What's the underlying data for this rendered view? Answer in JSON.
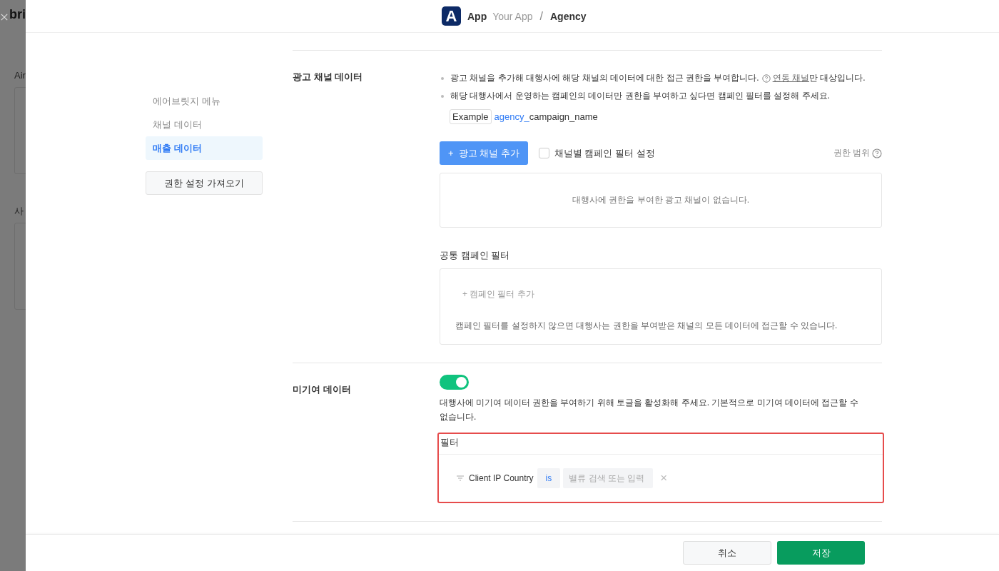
{
  "backdrop": {
    "texts": [
      "bri",
      "Air",
      "사"
    ]
  },
  "header": {
    "logo_letter": "A",
    "app": "App",
    "crumbs": [
      "Your App",
      "Agency"
    ],
    "separator": "/"
  },
  "sidebar": {
    "items": [
      {
        "label": "에어브릿지 메뉴",
        "selected": false
      },
      {
        "label": "채널 데이터",
        "selected": false
      },
      {
        "label": "매출 데이터",
        "selected": true
      }
    ],
    "import_button": "권한 설정 가져오기"
  },
  "ad_channel": {
    "title": "광고 채널 데이터",
    "bullet_1": {
      "text": "광고 채널을 추가해 대행사에 해당 채널의 데이터에 대한 접근 권한을 부여합니다.",
      "link": "연동 채널",
      "after": "만 대상입니다."
    },
    "bullet_2": "해당 대행사에서 운영하는 캠페인의 데이터만 권한을 부여하고 싶다면 캠페인 필터를 설정해 주세요.",
    "example": {
      "tag": "Example",
      "prefix": "agency_",
      "rest": "campaign_name"
    },
    "add_button": {
      "icon": "+",
      "label": "광고 채널 추가"
    },
    "checkbox": {
      "label": "채널별 캠페인 필터 설정",
      "checked": false
    },
    "scope_label": "권한 범위",
    "empty_message": "대행사에 권한을 부여한 광고 채널이 없습니다.",
    "common_filter": {
      "title": "공통 캠페인 필터",
      "add_icon": "+",
      "add_label": "캠페인 필터 추가",
      "note": "캠페인 필터를 설정하지 않으면 대행사는 권한을 부여받은 채널의 모든 데이터에 접근할 수 있습니다."
    }
  },
  "unattributed": {
    "title": "미기여 데이터",
    "toggle": {
      "on": true
    },
    "description": "대행사에 미기여 데이터 권한을 부여하기 위해 토글을 활성화해 주세요. 기본적으로 미기여 데이터에 접근할 수 없습니다.",
    "filter": {
      "title": "필터",
      "highlighted": true,
      "field": "Client IP Country",
      "operator": "is",
      "placeholder": "밸류 검색 또는 입력",
      "remove": "×"
    }
  },
  "footer": {
    "cancel": "취소",
    "save": "저장"
  }
}
